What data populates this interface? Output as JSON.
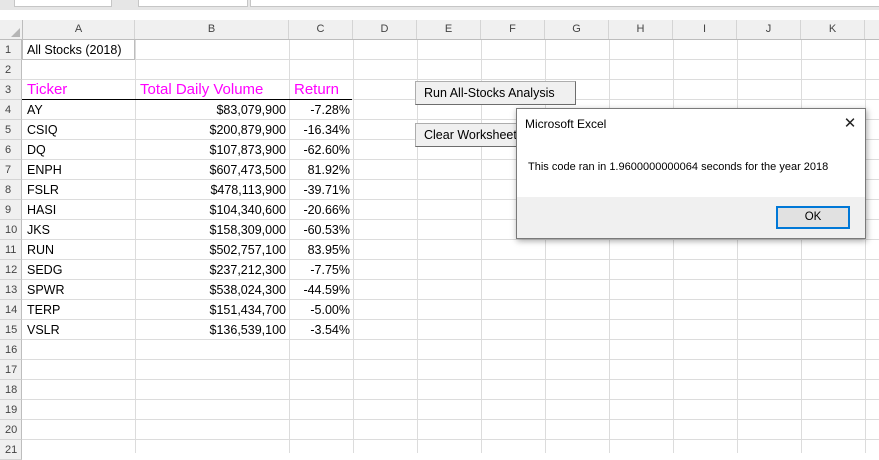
{
  "formula_bar": {
    "name_box": "",
    "formula": ""
  },
  "columns": [
    "A",
    "B",
    "C",
    "D",
    "E",
    "F",
    "G",
    "H",
    "I",
    "J",
    "K"
  ],
  "rows": [
    "1",
    "2",
    "3",
    "4",
    "5",
    "6",
    "7",
    "8",
    "9",
    "10",
    "11",
    "12",
    "13",
    "14",
    "15",
    "16",
    "17",
    "18",
    "19",
    "20",
    "21"
  ],
  "sheet": {
    "title": "All Stocks (2018)",
    "headers": {
      "ticker": "Ticker",
      "volume": "Total Daily Volume",
      "return": "Return"
    },
    "data": [
      {
        "ticker": "AY",
        "volume": "$83,079,900",
        "return": "-7.28%"
      },
      {
        "ticker": "CSIQ",
        "volume": "$200,879,900",
        "return": "-16.34%"
      },
      {
        "ticker": "DQ",
        "volume": "$107,873,900",
        "return": "-62.60%"
      },
      {
        "ticker": "ENPH",
        "volume": "$607,473,500",
        "return": "81.92%"
      },
      {
        "ticker": "FSLR",
        "volume": "$478,113,900",
        "return": "-39.71%"
      },
      {
        "ticker": "HASI",
        "volume": "$104,340,600",
        "return": "-20.66%"
      },
      {
        "ticker": "JKS",
        "volume": "$158,309,000",
        "return": "-60.53%"
      },
      {
        "ticker": "RUN",
        "volume": "$502,757,100",
        "return": "83.95%"
      },
      {
        "ticker": "SEDG",
        "volume": "$237,212,300",
        "return": "-7.75%"
      },
      {
        "ticker": "SPWR",
        "volume": "$538,024,300",
        "return": "-44.59%"
      },
      {
        "ticker": "TERP",
        "volume": "$151,434,700",
        "return": "-5.00%"
      },
      {
        "ticker": "VSLR",
        "volume": "$136,539,100",
        "return": "-3.54%"
      }
    ]
  },
  "buttons": {
    "run": "Run All-Stocks Analysis",
    "clear": "Clear Worksheet"
  },
  "dialog": {
    "title": "Microsoft Excel",
    "message": "This code ran in 1.9600000000064 seconds for the year 2018",
    "ok": "OK",
    "close_icon": "close-icon"
  },
  "colors": {
    "header_text": "#ff00ff",
    "ok_border": "#0078d7"
  }
}
